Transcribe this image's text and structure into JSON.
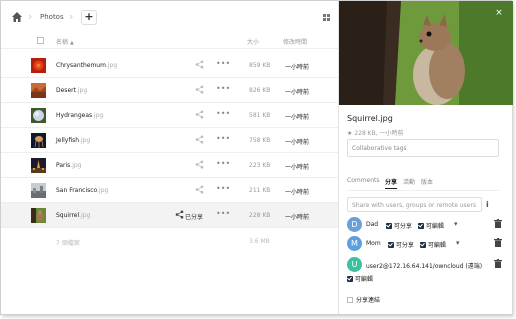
{
  "breadcrumb": {
    "folder": "Photos"
  },
  "list_header": {
    "name": "名稱",
    "sort_arrow": "▲",
    "size": "大小",
    "modified": "修改時間"
  },
  "files": [
    {
      "name": "Chrysanthemum",
      "ext": ".jpg",
      "size": "859 KB",
      "modified": "一小時前",
      "thumb": "chrysanthemum",
      "shared": false
    },
    {
      "name": "Desert",
      "ext": ".jpg",
      "size": "826 KB",
      "modified": "一小時前",
      "thumb": "desert",
      "shared": false
    },
    {
      "name": "Hydrangeas",
      "ext": ".jpg",
      "size": "581 KB",
      "modified": "一小時前",
      "thumb": "hydrangeas",
      "shared": false
    },
    {
      "name": "Jellyfish",
      "ext": ".jpg",
      "size": "758 KB",
      "modified": "一小時前",
      "thumb": "jellyfish",
      "shared": false
    },
    {
      "name": "Paris",
      "ext": ".jpg",
      "size": "223 KB",
      "modified": "一小時前",
      "thumb": "paris",
      "shared": false
    },
    {
      "name": "San Francisco",
      "ext": ".jpg",
      "size": "211 KB",
      "modified": "一小時前",
      "thumb": "sanfrancisco",
      "shared": false
    },
    {
      "name": "Squirrel",
      "ext": ".jpg",
      "size": "228 KB",
      "modified": "一小時前",
      "thumb": "squirrel",
      "shared": true,
      "shared_label": "已分享"
    }
  ],
  "summary": {
    "count": "7 個檔案",
    "total": "3.6 MB"
  },
  "details": {
    "filename": "Squirrel.jpg",
    "meta": "228 KB, 一小時前",
    "tags_placeholder": "Collaborative tags",
    "tabs": [
      "Comments",
      "分享",
      "活動",
      "版本"
    ],
    "active_tab": "分享",
    "share_placeholder": "Share with users, groups or remote users",
    "shares": [
      {
        "avatar_letter": "D",
        "avatar_color": "#6a9fd8",
        "name": "Dad",
        "can_share": "可分享",
        "can_edit": "可編輯"
      },
      {
        "avatar_letter": "M",
        "avatar_color": "#5aa0e0",
        "name": "Mom",
        "can_share": "可分享",
        "can_edit": "可編輯"
      },
      {
        "avatar_letter": "U",
        "avatar_color": "#3cc0a0",
        "name": "user2@172.16.64.141/owncloud (遠端)",
        "can_edit": "可編輯"
      }
    ],
    "share_link_label": "分享連結"
  },
  "colors": {
    "checkbox": "#1d2d44",
    "selected_row": "#f3f3f3"
  }
}
